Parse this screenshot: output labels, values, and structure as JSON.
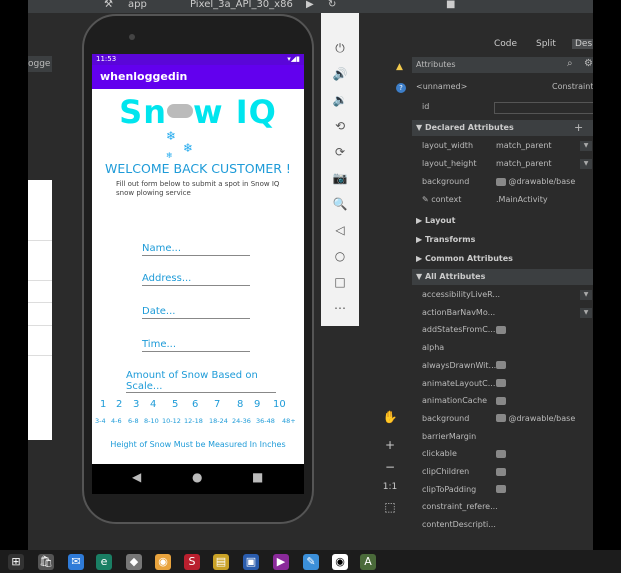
{
  "topbar": {
    "config": "app",
    "device": "Pixel_3a_API_30_x86"
  },
  "left_label": "ogge",
  "phone": {
    "status_time": "11:53",
    "app_title": "whenloggedin",
    "logo_text_left": "Sn",
    "logo_text_right": "w IQ",
    "welcome": "WELCOME BACK CUSTOMER !",
    "subtitle_line1": "Fill out form below to submit a spot in Snow IQ",
    "subtitle_line2": "snow plowing service",
    "fields": [
      {
        "placeholder": "Name..."
      },
      {
        "placeholder": "Address..."
      },
      {
        "placeholder": "Date..."
      },
      {
        "placeholder": "Time..."
      }
    ],
    "snow_amount": "Amount of Snow Based on Scale...",
    "scale_numbers": [
      "1",
      "2",
      "3",
      "4",
      "5",
      "6",
      "7",
      "8",
      "9",
      "10"
    ],
    "scale_ranges": [
      "3-4",
      "4-6",
      "6-8",
      "8-10",
      "10-12",
      "12-18",
      "18-24",
      "24-36",
      "36-48",
      "48+"
    ],
    "height_note": "Height of Snow Must be Measured In Inches"
  },
  "view_toggle": {
    "code": "Code",
    "split": "Split",
    "design": "Design"
  },
  "attributes": {
    "title": "Attributes",
    "component_name": "<unnamed>",
    "component_type": "ConstraintLayout",
    "id_label": "id",
    "sections": {
      "declared": "Declared Attributes",
      "layout": "Layout",
      "transforms": "Transforms",
      "common": "Common Attributes",
      "all": "All Attributes"
    },
    "declared_rows": [
      {
        "name": "layout_width",
        "value": "match_parent"
      },
      {
        "name": "layout_height",
        "value": "match_parent"
      },
      {
        "name": "background",
        "value": "@drawable/base"
      },
      {
        "name": "context",
        "value": ".MainActivity"
      }
    ],
    "all_rows": [
      {
        "name": "accessibilityLiveR...",
        "value": ""
      },
      {
        "name": "actionBarNavMo...",
        "value": ""
      },
      {
        "name": "addStatesFromC...",
        "value": ""
      },
      {
        "name": "alpha",
        "value": ""
      },
      {
        "name": "alwaysDrawnWit...",
        "value": ""
      },
      {
        "name": "animateLayoutC...",
        "value": ""
      },
      {
        "name": "animationCache",
        "value": ""
      },
      {
        "name": "background",
        "value": "@drawable/base"
      },
      {
        "name": "barrierMargin",
        "value": ""
      },
      {
        "name": "clickable",
        "value": ""
      },
      {
        "name": "clipChildren",
        "value": ""
      },
      {
        "name": "clipToPadding",
        "value": ""
      },
      {
        "name": "constraint_refere...",
        "value": ""
      },
      {
        "name": "contentDescripti...",
        "value": ""
      }
    ]
  },
  "zoom": {
    "ratio": "1:1"
  },
  "colors": {
    "accent": "#6200ee",
    "logo": "#00e5ee",
    "text_blue": "#1e9bd8"
  }
}
